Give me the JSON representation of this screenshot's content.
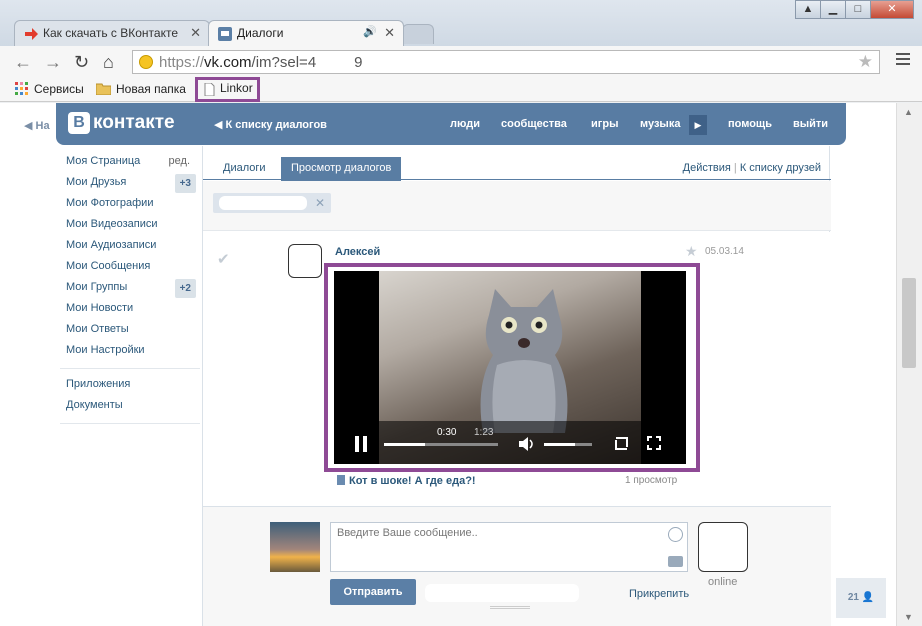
{
  "browser": {
    "tabs": [
      {
        "title": "Как скачать с ВКонтакте"
      },
      {
        "title": "Диалоги"
      }
    ],
    "url_prefix": "https://",
    "url_host": "vk.com",
    "url_path": "/im?sel=4",
    "url_tail": "9",
    "bookmarks": [
      {
        "label": "Сервисы",
        "icon": "apps-icon"
      },
      {
        "label": "Новая папка",
        "icon": "folder-icon"
      },
      {
        "label": "Linkor",
        "icon": "page-icon"
      }
    ]
  },
  "colors": {
    "vk_blue": "#587ca3",
    "highlight": "#8e4a95",
    "link": "#2b587a"
  },
  "vk": {
    "logo": "контакте",
    "logo_letter": "В",
    "back_link": "К списку диалогов",
    "side_fragment": "На",
    "nav": [
      "люди",
      "сообщества",
      "игры",
      "музыка",
      "помощь",
      "выйти"
    ]
  },
  "left_menu": {
    "items": [
      {
        "label": "Моя Страница",
        "extra": "ред."
      },
      {
        "label": "Мои Друзья",
        "badge": "+3"
      },
      {
        "label": "Мои Фотографии"
      },
      {
        "label": "Мои Видеозаписи"
      },
      {
        "label": "Мои Аудиозаписи"
      },
      {
        "label": "Мои Сообщения"
      },
      {
        "label": "Мои Группы",
        "badge": "+2"
      },
      {
        "label": "Мои Новости"
      },
      {
        "label": "Мои Ответы"
      },
      {
        "label": "Мои Настройки"
      }
    ],
    "extra_items": [
      {
        "label": "Приложения"
      },
      {
        "label": "Документы"
      }
    ]
  },
  "dialogs": {
    "tabs": [
      "Диалоги",
      "Просмотр диалогов"
    ],
    "actions": "Действия",
    "separator": "|",
    "friends_link": "К списку друзей"
  },
  "message": {
    "author": "Алексей",
    "date": "05.03.14",
    "video": {
      "current_time": "0:30",
      "duration": "1:23",
      "progress": 0.36,
      "volume": 0.65,
      "title": "Кот в шоке! А где еда?!",
      "views": "1 просмотр"
    }
  },
  "compose": {
    "placeholder": "Введите Ваше сообщение..",
    "send": "Отправить",
    "attach": "Прикрепить",
    "status": "online"
  },
  "online_count": "21"
}
